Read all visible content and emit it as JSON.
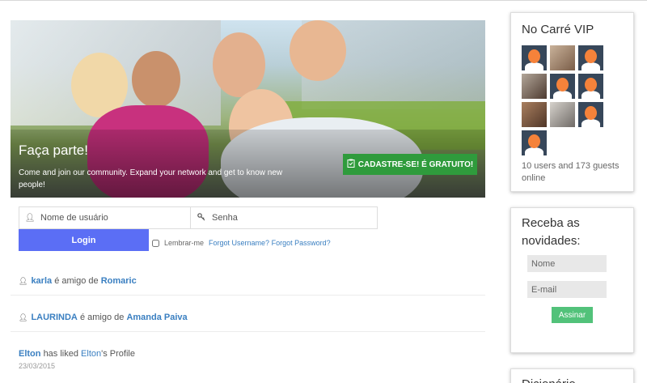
{
  "hero": {
    "title": "Faça parte!",
    "subtitle": "Come and join our community. Expand your network and get to know new people!",
    "cta_label": "CADASTRE-SE! É GRATUITO!",
    "cta_color": "#2f9b3c"
  },
  "login": {
    "username_placeholder": "Nome de usuário",
    "password_placeholder": "Senha",
    "button_label": "Login",
    "button_color": "#5b6ef5",
    "remember_label": "Lembrar-me",
    "forgot_username": "Forgot Username?",
    "forgot_password": "Forgot Password?"
  },
  "activity": [
    {
      "actor": "karla",
      "verb": "é amigo de",
      "target": "Romaric"
    },
    {
      "actor": "LAURINDA",
      "verb": "é amigo de",
      "target": "Amanda Paiva"
    },
    {
      "actor": "Elton",
      "verb": "has liked",
      "target": "Elton",
      "suffix": "'s Profile",
      "date": "23/03/2015"
    }
  ],
  "vip": {
    "title": "No Carré VIP",
    "online_text": "10 users and 173 guests online",
    "avatars": [
      "default",
      "photo",
      "default",
      "photo2",
      "default",
      "default",
      "photo3",
      "photo4",
      "default",
      "default"
    ]
  },
  "newsletter": {
    "title": "Receba as novidades:",
    "name_placeholder": "Nome",
    "email_placeholder": "E-mail",
    "button_label": "Assinar",
    "button_color": "#52c27a"
  },
  "next_widget": {
    "title": "Dicionário"
  }
}
